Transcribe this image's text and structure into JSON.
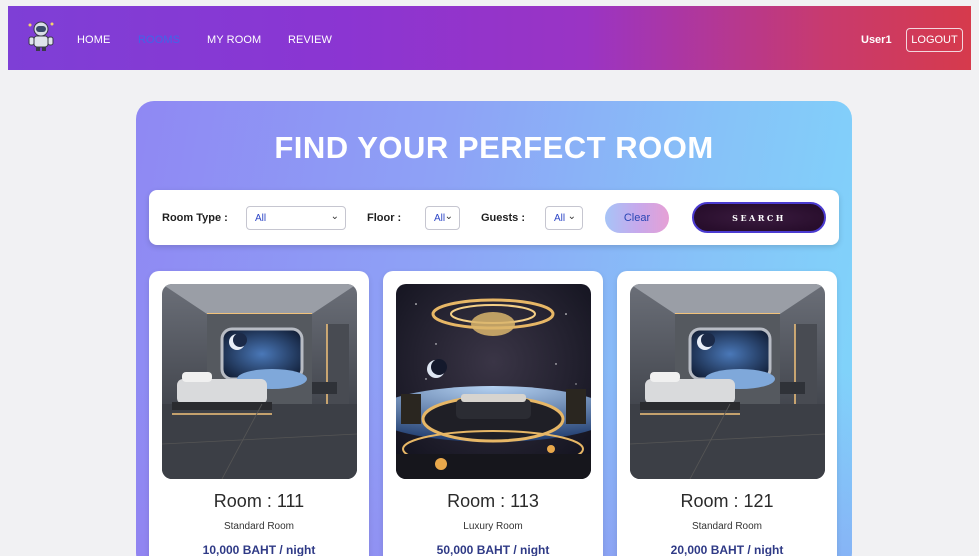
{
  "nav": {
    "logo_icon": "astronaut-icon",
    "links": [
      {
        "label": "HOME",
        "active": false
      },
      {
        "label": "ROOMS",
        "active": true
      },
      {
        "label": "MY ROOM",
        "active": false
      },
      {
        "label": "REVIEW",
        "active": false
      }
    ],
    "user": "User1",
    "logout_label": "LOGOUT"
  },
  "colors": {
    "nav_gradient_start": "#7e3fd6",
    "nav_gradient_end": "#d63a4c",
    "active_link": "#3f66e8",
    "price_text": "#2f3a86"
  },
  "hero": {
    "title": "FIND YOUR PERFECT ROOM"
  },
  "filters": {
    "room_type": {
      "label": "Room Type :",
      "value": "All"
    },
    "floor": {
      "label": "Floor :",
      "value": "All"
    },
    "guests": {
      "label": "Guests :",
      "value": "All"
    },
    "clear_label": "Clear",
    "search_label": "SEARCH"
  },
  "rooms": [
    {
      "number": "Room : 111",
      "type": "Standard Room",
      "price": "10,000 BAHT / night",
      "image": "standard-room-image"
    },
    {
      "number": "Room : 113",
      "type": "Luxury Room",
      "price": "50,000 BAHT / night",
      "image": "luxury-room-image"
    },
    {
      "number": "Room : 121",
      "type": "Standard Room",
      "price": "20,000 BAHT / night",
      "image": "standard-room-image"
    }
  ]
}
